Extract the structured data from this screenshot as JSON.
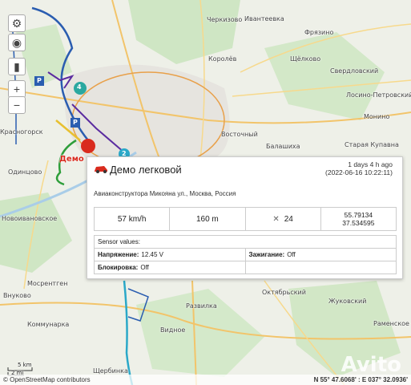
{
  "map": {
    "labels": [
      {
        "id": "cherkizovo",
        "text": "Черкизово"
      },
      {
        "id": "ivanteevka",
        "text": "Ивантеевка"
      },
      {
        "id": "shchelkovo",
        "text": "Щёлково"
      },
      {
        "id": "fryazino",
        "text": "Фрязино"
      },
      {
        "id": "korolev",
        "text": "Королёв"
      },
      {
        "id": "sverdlovsky",
        "text": "Свердловский"
      },
      {
        "id": "losino",
        "text": "Лосино-Петровский"
      },
      {
        "id": "monino",
        "text": "Монино"
      },
      {
        "id": "vostochny",
        "text": "Восточный"
      },
      {
        "id": "balashikha",
        "text": "Балашиха"
      },
      {
        "id": "staraya",
        "text": "Старая Купавна"
      },
      {
        "id": "krasnogorsk",
        "text": "Красногорск"
      },
      {
        "id": "odintsovo",
        "text": "Одинцово"
      },
      {
        "id": "novoivanovskoe",
        "text": "Новоивановское"
      },
      {
        "id": "mosrentgen",
        "text": "Мосрентген"
      },
      {
        "id": "vnukovo",
        "text": "Внуково"
      },
      {
        "id": "kommunarka",
        "text": "Коммунарка"
      },
      {
        "id": "shcherbinka",
        "text": "Щербинка"
      },
      {
        "id": "razvilka",
        "text": "Развилка"
      },
      {
        "id": "oktyabrsky",
        "text": "Октябрьский"
      },
      {
        "id": "vidnoe",
        "text": "Видное"
      },
      {
        "id": "zhukovsky",
        "text": "Жуковский"
      },
      {
        "id": "ramenskoe",
        "text": "Раменское"
      }
    ],
    "vehicle_label": "Демо л",
    "markers": {
      "cluster_4": "4",
      "cluster_2": "2",
      "parking": "P"
    }
  },
  "controls": {
    "zoom_in": "+",
    "zoom_out": "−"
  },
  "popup": {
    "title": "Демо легковой",
    "ago_line1": "1 days 4 h ago",
    "ago_line2": "(2022-06-16 10:22:11)",
    "address": "Авиаконструктора Микояна ул., Москва, Россия",
    "speed": "57 km/h",
    "altitude": "160 m",
    "satellites": "24",
    "lat": "55.79134",
    "lon": "37.534595",
    "sensors_header": "Sensor values:",
    "sensors": [
      {
        "label": "Напряжение:",
        "value": "12.45 V"
      },
      {
        "label": "Зажигание:",
        "value": "Off"
      },
      {
        "label": "Блокировка:",
        "value": "Off"
      }
    ]
  },
  "scale": {
    "km": "5 km",
    "mi": "2 mi"
  },
  "attribution": "© OpenStreetMap contributors",
  "coords": "N 55° 47.6068' : E 037° 32.0936'",
  "watermark": "Avito",
  "colors": {
    "track_blue": "#2a5db0",
    "track_purple": "#5b2ca0",
    "track_cyan": "#2aa8c8",
    "track_green": "#2e9e3a",
    "vehicle_red": "#d92b1e"
  }
}
